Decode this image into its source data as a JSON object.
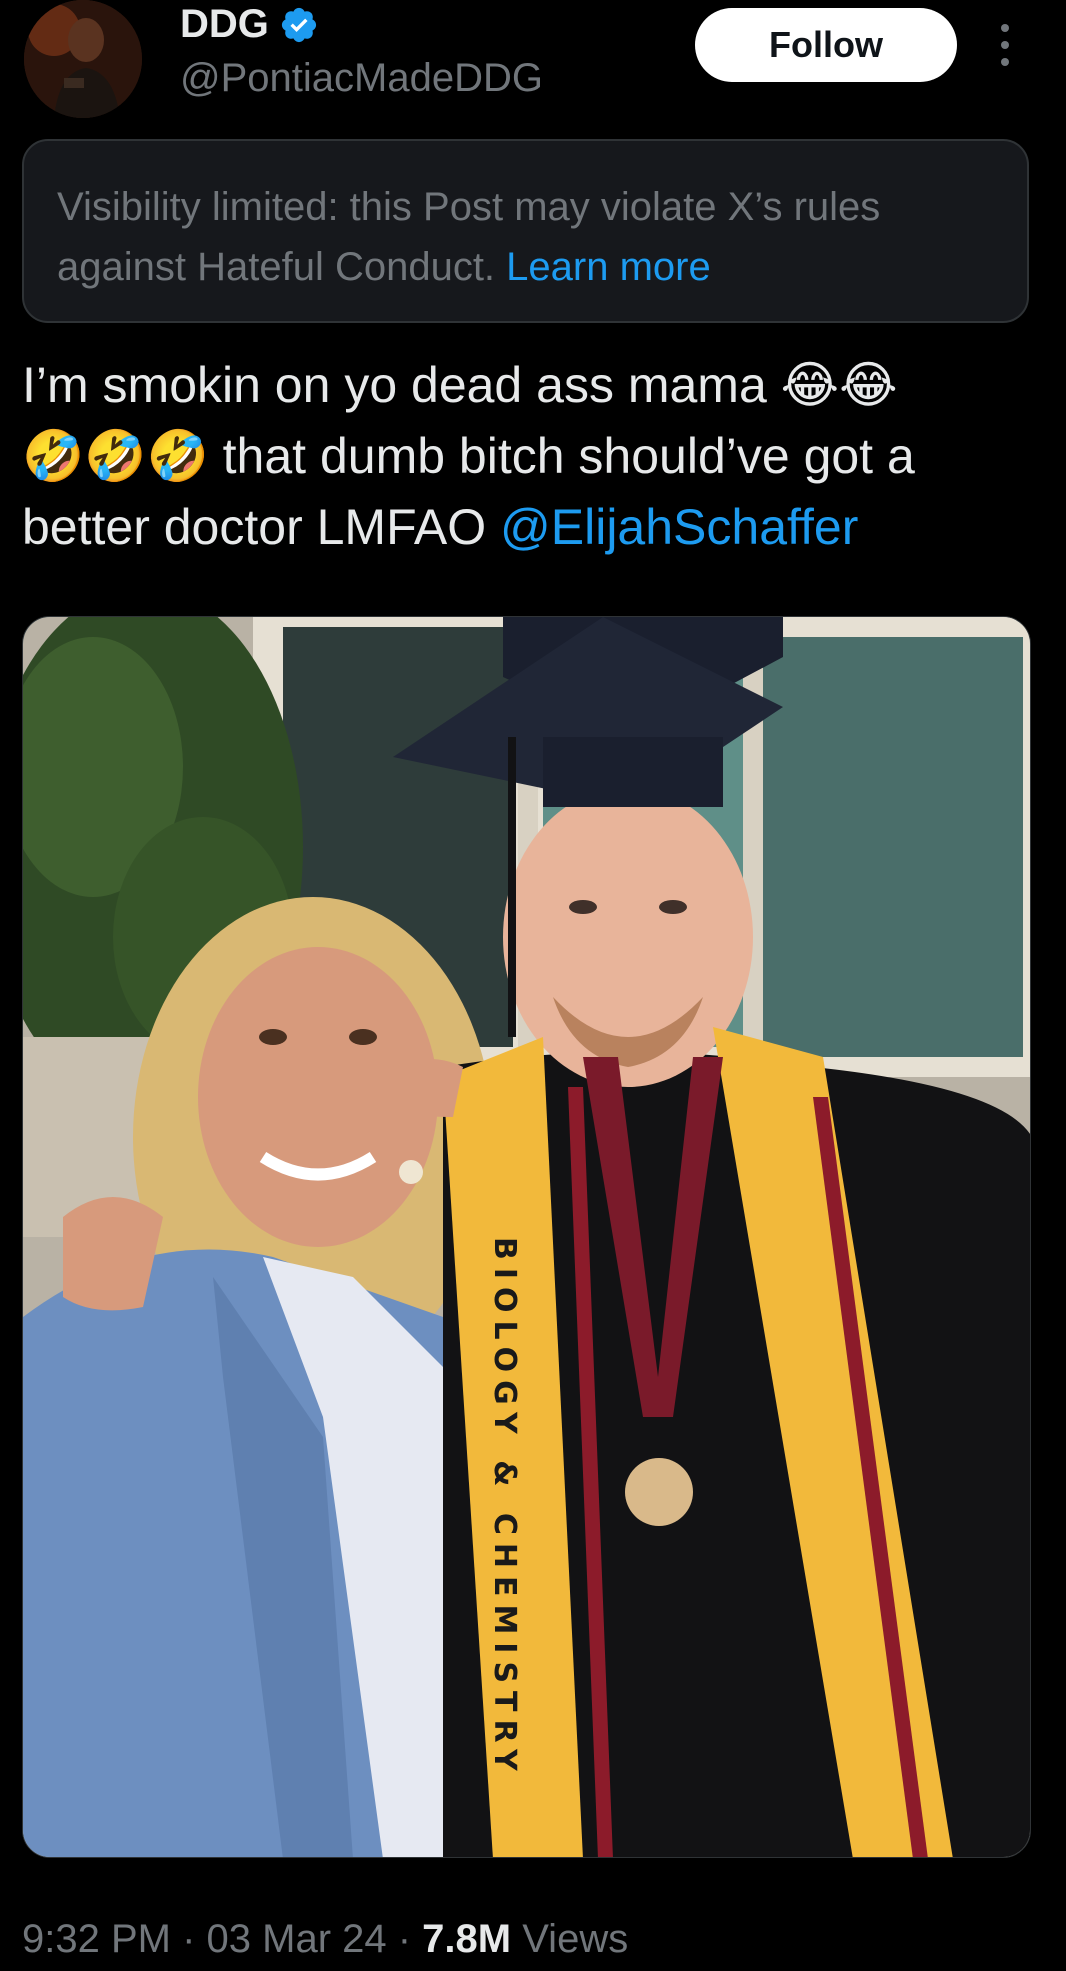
{
  "author": {
    "display_name": "DDG",
    "handle": "@PontiacMadeDDG",
    "verified": true,
    "avatar_icon": "profile-photo"
  },
  "header": {
    "follow_label": "Follow",
    "more_icon": "vertical-ellipsis-icon"
  },
  "notice": {
    "text": "Visibility limited: this Post may violate X’s rules against Hateful Conduct.",
    "link_label": "Learn more"
  },
  "tweet": {
    "line1": "I’m smokin on yo dead ass mama 😂😂",
    "line2": "🤣🤣🤣 that dumb bitch should’ve got a",
    "line3_text": "better doctor LMFAO",
    "mention": "@ElijahSchaffer"
  },
  "media": {
    "sash_text": "BIOLOGY & CHEMISTRY"
  },
  "meta": {
    "time": "9:32 PM",
    "sep1": " · ",
    "date": "03 Mar 24",
    "sep2": " · ",
    "views_count": "7.8M",
    "views_label": " Views"
  },
  "colors": {
    "background": "#000000",
    "accent": "#1d9bf0",
    "text_primary": "#e7e9ea",
    "text_secondary": "#71767b"
  }
}
